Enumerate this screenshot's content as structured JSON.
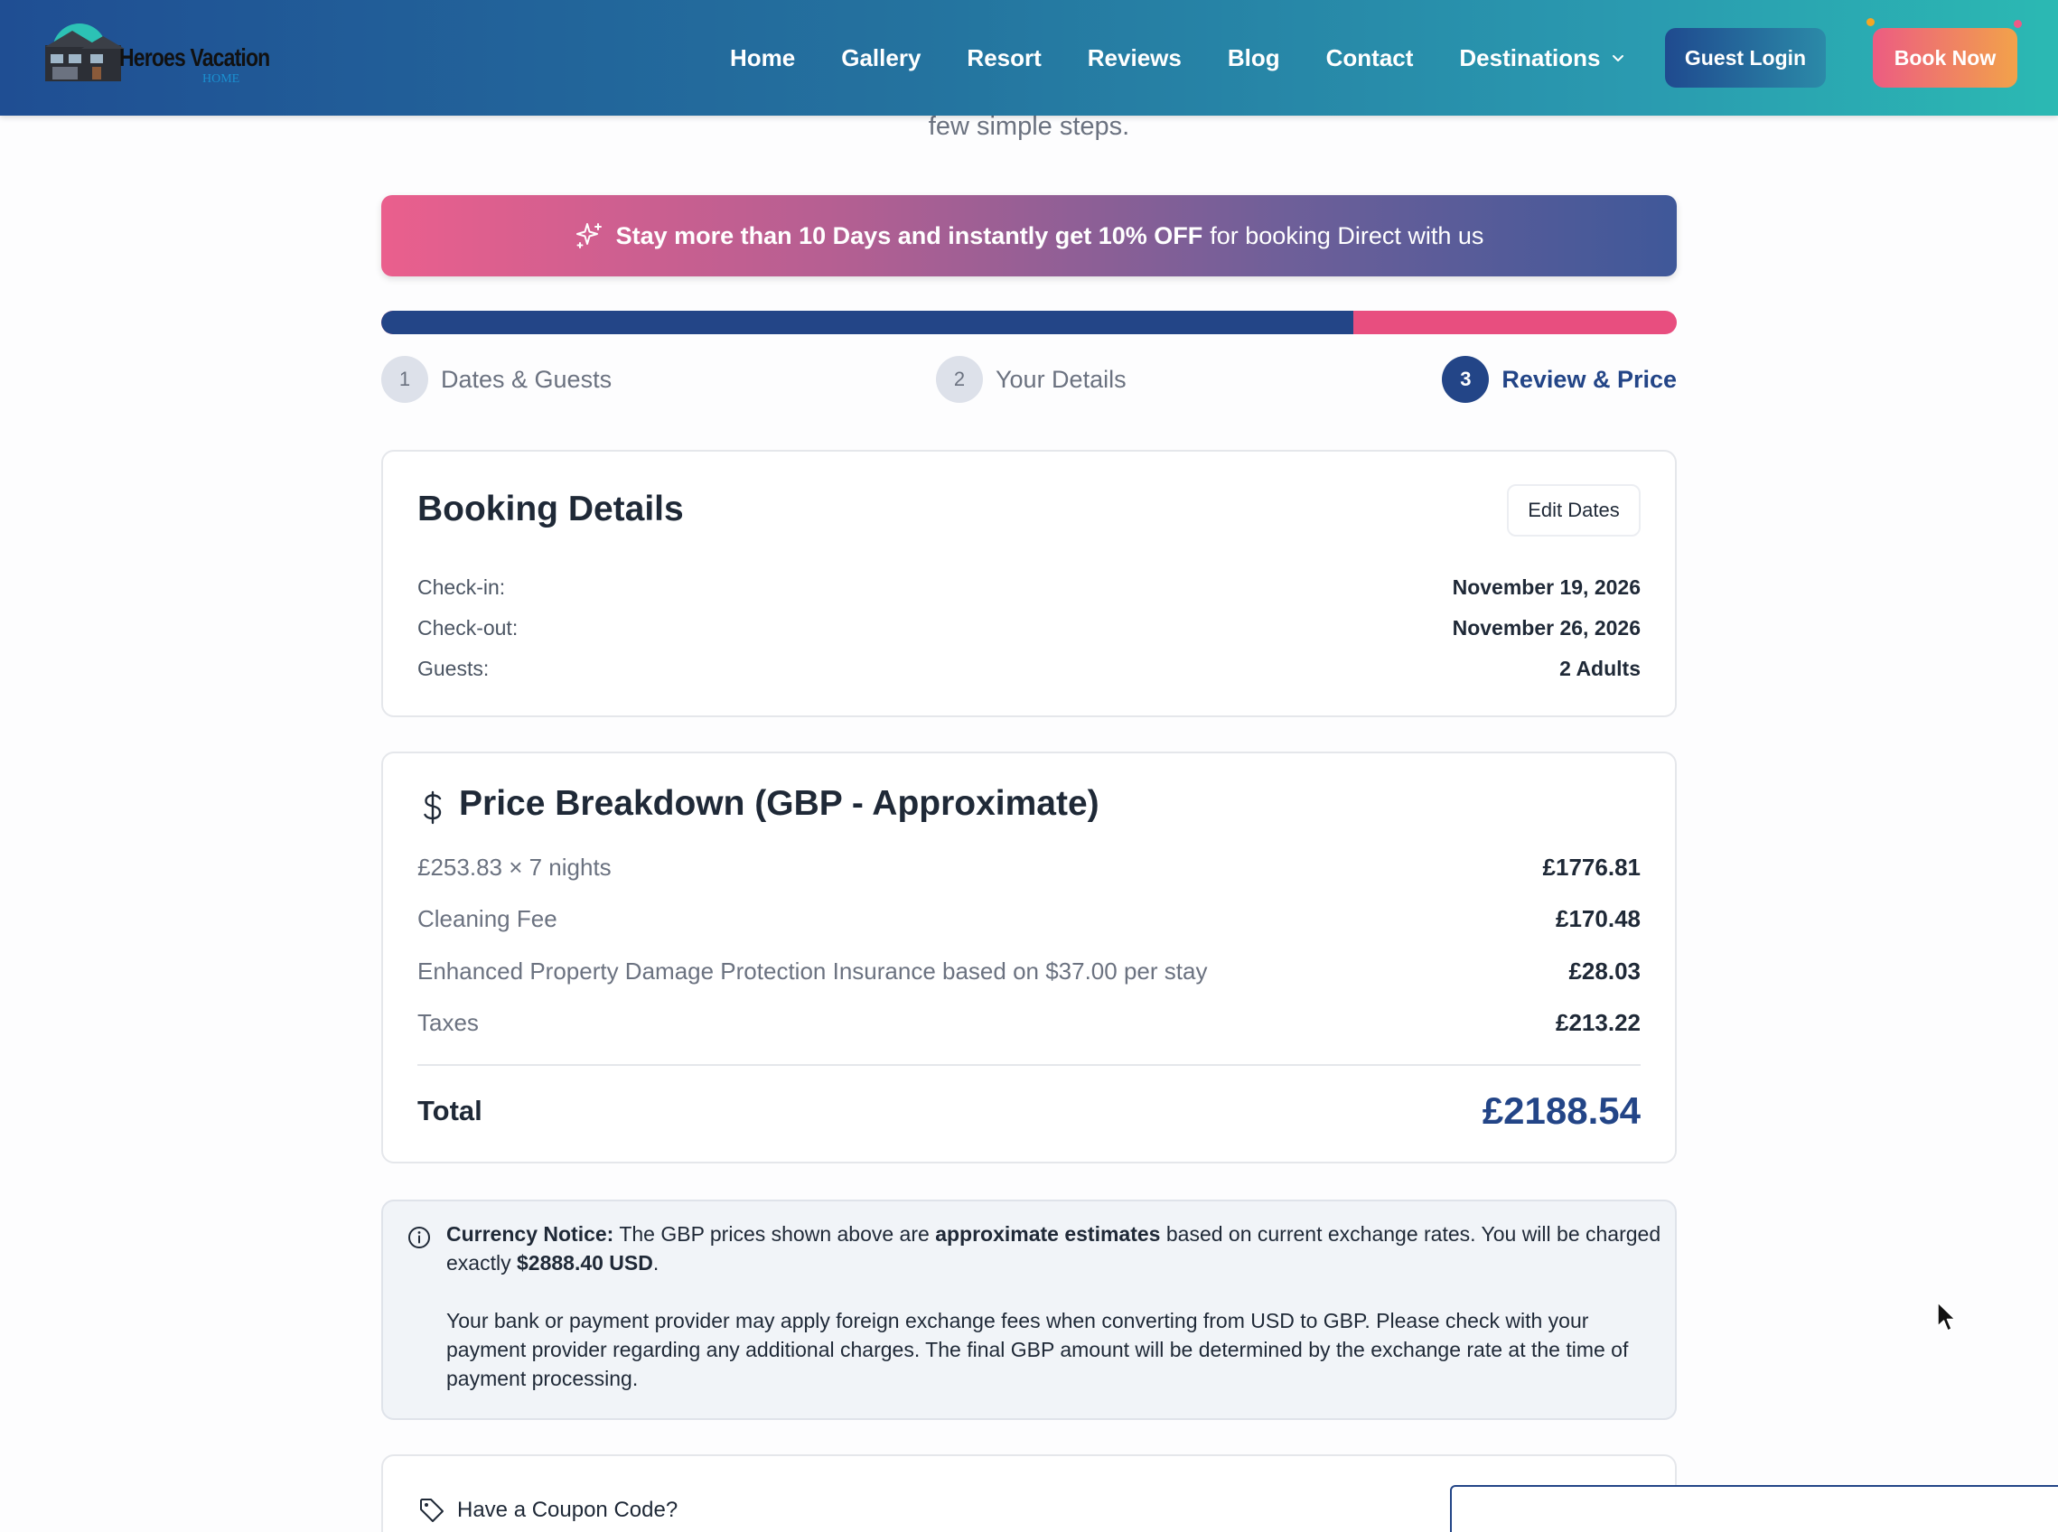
{
  "brand": {
    "name": "Heroes Vacation",
    "sub": "HOME"
  },
  "nav": {
    "items": [
      "Home",
      "Gallery",
      "Resort",
      "Reviews",
      "Blog",
      "Contact"
    ],
    "dropdown_label": "Destinations",
    "guest_login": "Guest Login",
    "book_now": "Book Now"
  },
  "subtitle": "few simple steps.",
  "promo": {
    "bold": "Stay more than 10 Days and instantly get 10% OFF",
    "rest": "for booking Direct with us"
  },
  "progress": {
    "percent": 75
  },
  "steps": [
    {
      "num": "1",
      "label": "Dates & Guests",
      "active": false
    },
    {
      "num": "2",
      "label": "Your Details",
      "active": false
    },
    {
      "num": "3",
      "label": "Review & Price",
      "active": true
    }
  ],
  "booking": {
    "title": "Booking Details",
    "edit_label": "Edit Dates",
    "rows": [
      {
        "label": "Check-in:",
        "value": "November 19, 2026"
      },
      {
        "label": "Check-out:",
        "value": "November 26, 2026"
      },
      {
        "label": "Guests:",
        "value": "2 Adults"
      }
    ]
  },
  "price": {
    "title": "Price Breakdown (GBP - Approximate)",
    "rows": [
      {
        "label": "£253.83 × 7 nights",
        "value": "£1776.81"
      },
      {
        "label": "Cleaning Fee",
        "value": "£170.48"
      },
      {
        "label": "Enhanced Property Damage Protection Insurance based on $37.00 per stay",
        "value": "£28.03"
      },
      {
        "label": "Taxes",
        "value": "£213.22"
      }
    ],
    "total_label": "Total",
    "total_value": "£2188.54"
  },
  "notice": {
    "heading": "Currency Notice:",
    "p1_a": "The GBP prices shown above are",
    "p1_bold": "approximate estimates",
    "p1_b": "based on current exchange rates. You will be charged exactly",
    "p1_amount": "$2888.40 USD",
    "p2": "Your bank or payment provider may apply foreign exchange fees when converting from USD to GBP. Please check with your payment provider regarding any additional charges. The final GBP amount will be determined by the exchange rate at the time of payment processing."
  },
  "coupon": {
    "label": "Have a Coupon Code?",
    "value": ""
  },
  "icons": {
    "sparkle": "sparkle-icon",
    "dollar": "dollar-icon",
    "info": "info-icon",
    "tag": "tag-icon",
    "chevron": "chevron-down-icon",
    "cursor": "mouse-cursor-icon"
  },
  "colors": {
    "primary": "#234587",
    "accent": "#e84e7f",
    "header_start": "#1f4e93",
    "header_end": "#2bb9b3"
  }
}
